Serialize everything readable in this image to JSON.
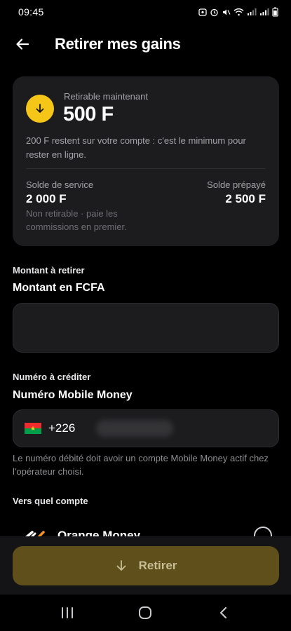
{
  "status_bar": {
    "time": "09:45"
  },
  "header": {
    "title": "Retirer mes gains"
  },
  "balance_card": {
    "available_label": "Retirable maintenant",
    "available_amount": "500 F",
    "minimum_note": "200 F restent sur votre compte : c'est le minimum pour rester en ligne.",
    "service_label": "Solde de service",
    "service_amount": "2 000 F",
    "service_note": "Non retirable · paie les commissions en premier.",
    "prepaid_label": "Solde prépayé",
    "prepaid_amount": "2 500 F"
  },
  "amount_section": {
    "section_label": "Montant à retirer",
    "field_label": "Montant en FCFA",
    "value": ""
  },
  "phone_section": {
    "section_label": "Numéro à créditer",
    "field_label": "Numéro Mobile Money",
    "country_code": "+226",
    "helper": "Le numéro débité doit avoir un compte Mobile Money actif chez l'opérateur choisi."
  },
  "account_section": {
    "section_label": "Vers quel compte",
    "operators": [
      {
        "name": "Orange Money",
        "selected": false
      }
    ]
  },
  "action": {
    "withdraw_label": "Retirer"
  },
  "colors": {
    "accent": "#f5c518",
    "button_disabled": "#5e4f1b",
    "card_bg": "#1c1c1e"
  }
}
